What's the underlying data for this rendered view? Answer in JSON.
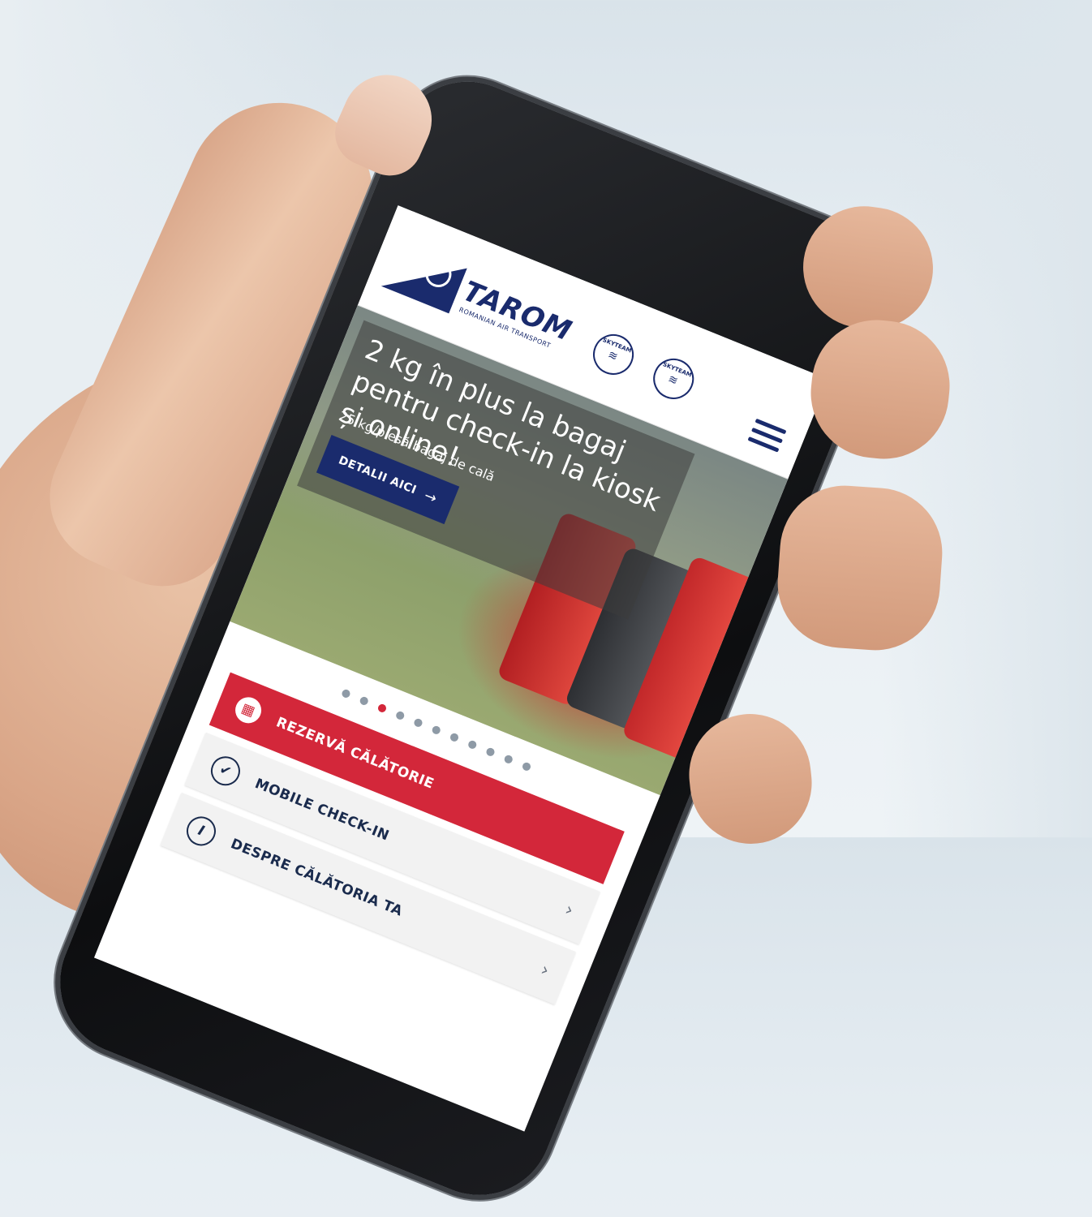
{
  "brand": {
    "logo_text": "TAROM",
    "logo_subtitle": "ROMANIAN AIR TRANSPORT",
    "skyteam_label": "SKYTEAM"
  },
  "hero": {
    "title": "2 kg în plus la bagaj pentru check-in la kiosk și online!",
    "subtitle": "25 kg/piesă bagaj de cală",
    "button_label": "DETALII AICI",
    "button_arrow": "→"
  },
  "carousel": {
    "dot_count": 11,
    "active_index": 2
  },
  "menu": {
    "items": [
      {
        "label": "REZERVĂ CĂLĂTORIE",
        "icon": "calendar-icon",
        "glyph": "▦",
        "style": "primary",
        "chevron": ""
      },
      {
        "label": "MOBILE CHECK-IN",
        "icon": "check-icon",
        "glyph": "✔",
        "style": "secondary",
        "chevron": "›"
      },
      {
        "label": "DESPRE CĂLĂTORIA TA",
        "icon": "info-icon",
        "glyph": "i",
        "style": "secondary",
        "chevron": "›"
      }
    ]
  },
  "colors": {
    "brand_navy": "#1a2b6d",
    "accent_red": "#d3273a",
    "dot_inactive": "#8e9aa6"
  }
}
